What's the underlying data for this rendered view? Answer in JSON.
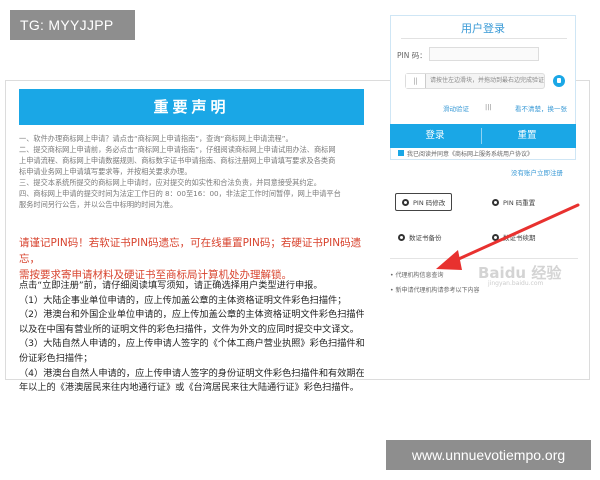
{
  "tag_badge": "TG: MYYJJPP",
  "site_badge": "www.unnuevotiempo.org",
  "notice": {
    "header": "重要声明",
    "body_lines": [
      "一、软件办理商标网上申请？请点击“商标网上申请指南”，查询“商标网上申请流程”。",
      "二、提交商标网上申请前，务必点击“商标网上申请指南”，仔细阅读商标网上申请试用办法、商标网",
      "上申请流程、商标网上申请数据规则、商标数字证书申请指南、商标注册网上申请填写要求及各类商",
      "标申请业务网上申请填写要求等，并按相关要求办理。",
      "三、提交本系统所提交的商标网上申请时，应对提交的如实性和合法负责，并同意接受其约定。",
      "四、商标网上申请的提交时间为法定工作日的 8：00至16：00，非法定工作时间暂停，网上申请平台",
      "服务时间另行公告，并以公告中标明的时间为准。"
    ],
    "warning_lines": [
      "请谨记PIN码！若软证书PIN码遗忘，可在线重置PIN码；若硬证书PIN码遗忘，",
      "需按要求寄申请材料及硬证书至商标局计算机处办理解锁。"
    ],
    "instructions": [
      "点击“立即注册”前，请仔细阅读填写须知，请正确选择用户类型进行申报。",
      "（1）大陆企事业单位申请的，应上传加盖公章的主体资格证明文件彩色扫描件；",
      "（2）港澳台和外国企业单位申请的，应上传加盖公章的主体资格证明文件彩色扫描件，",
      "以及在中国有营业所的证明文件的彩色扫描件，文件为外文的应同时提交中文译文。",
      "（3）大陆自然人申请的，应上传申请人签字的《个体工商户营业执照》彩色扫描件和身",
      "份证彩色扫描件；",
      "（4）港澳台自然人申请的，应上传申请人签字的身份证明文件彩色扫描件和有效期在一",
      "年以上的《港澳居民来往内地通行证》或《台湾居民来往大陆通行证》彩色扫描件。"
    ]
  },
  "login": {
    "title": "用户登录",
    "pin_label": "PIN 码：",
    "pin_placeholder": "",
    "slider_handle": "||",
    "slider_text": "请按住左边滑块，并拖动到最右边完成验证",
    "dynamic_link": "滑动验证",
    "dynamic_num": "|||",
    "unclear_link": "看不清楚，换一张",
    "login_button": "登录",
    "reset_button": "重置",
    "agree_text": "我已阅读并同意《商标网上服务系统用户协议》",
    "register_link": "没有账户立即注册"
  },
  "options": {
    "pin_modify": "PIN 码修改",
    "pin_reset": "PIN 码重置",
    "cert_change": "数证书备份",
    "cert_renew": "数证书续期"
  },
  "links": [
    "代理机构信息查询",
    "新申请代理机构请参考以下内容"
  ],
  "watermark": "Baidu 经验",
  "watermark_sub": "jingyan.baidu.com",
  "colors": {
    "accent": "#1aa7e6",
    "warning": "#d8442f",
    "badge": "#8e8e8e",
    "arrow": "#e8312f"
  }
}
